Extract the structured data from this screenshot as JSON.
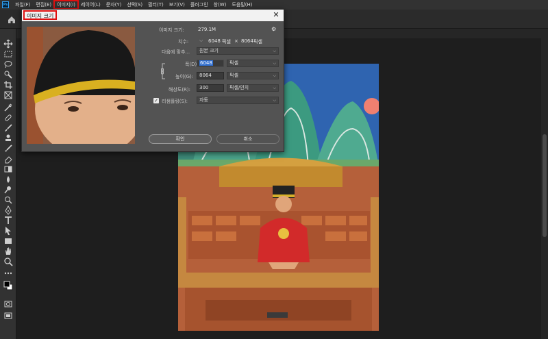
{
  "menubar": {
    "logo": "Ps",
    "items": [
      {
        "label": "파일(F)"
      },
      {
        "label": "편집(E)"
      },
      {
        "label": "이미지(I)",
        "highlighted": true
      },
      {
        "label": "레이어(L)"
      },
      {
        "label": "문자(Y)"
      },
      {
        "label": "선택(S)"
      },
      {
        "label": "필터(T)"
      },
      {
        "label": "보기(V)"
      },
      {
        "label": "플러그인"
      },
      {
        "label": "창(W)"
      },
      {
        "label": "도움말(H)"
      }
    ]
  },
  "toolbar": {
    "tools": [
      "move-icon",
      "marquee-icon",
      "lasso-icon",
      "quick-select-icon",
      "crop-icon",
      "frame-icon",
      "eyedropper-icon",
      "healing-brush-icon",
      "brush-icon",
      "clone-stamp-icon",
      "history-brush-icon",
      "eraser-icon",
      "gradient-icon",
      "blur-icon",
      "dodge-icon",
      "pen-icon",
      "type-icon",
      "path-select-icon",
      "rectangle-icon",
      "hand-icon",
      "zoom-icon",
      "more-tools-icon"
    ]
  },
  "dialog": {
    "title": "이미지 크기",
    "image_size_label": "이미지 크기:",
    "image_size_value": "279.1M",
    "dimensions_label": "치수:",
    "dimensions_width": "6048",
    "dimensions_unit_1": "픽셀",
    "dimensions_times": "×",
    "dimensions_height": "8064",
    "dimensions_unit_2": "픽셀",
    "fit_to_label": "다음에 맞추...",
    "fit_to_value": "원본 크기",
    "width_label": "폭(D):",
    "width_value": "6048",
    "width_unit": "픽셀",
    "height_label": "높이(G):",
    "height_value": "8064",
    "height_unit": "픽셀",
    "resolution_label": "해상도(R):",
    "resolution_value": "300",
    "resolution_unit": "픽셀/인치",
    "resample_label": "리샘플링(S):",
    "resample_checked": true,
    "resample_value": "자동",
    "ok_label": "확인",
    "cancel_label": "취소"
  },
  "colors": {
    "accent_red": "#e01010",
    "selection_blue": "#2f6ed0"
  }
}
